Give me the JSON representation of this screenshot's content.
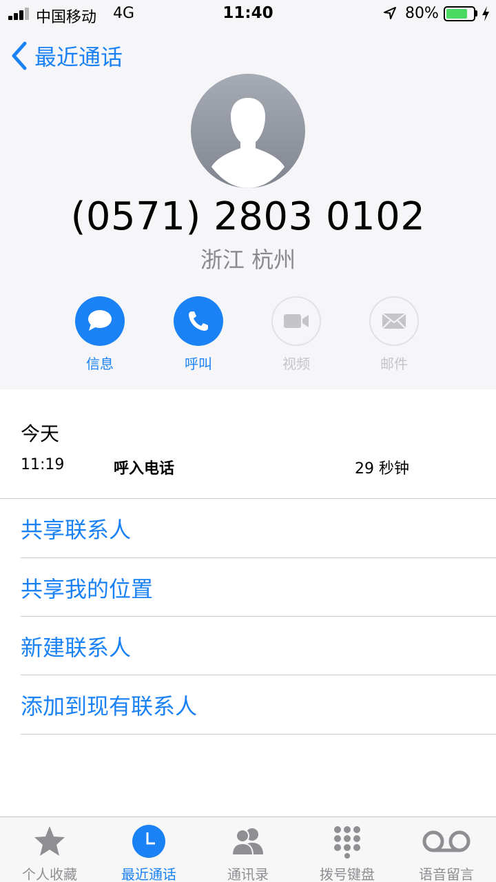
{
  "status_bar": {
    "carrier": "中国移动",
    "network": "4G",
    "time": "11:40",
    "battery_percent": "80%",
    "battery_level": 0.8
  },
  "nav": {
    "back_label": "最近通话"
  },
  "contact": {
    "phone_number": "(0571) 2803 0102",
    "location": "浙江 杭州"
  },
  "actions": [
    {
      "label": "信息",
      "icon": "message-icon",
      "enabled": true
    },
    {
      "label": "呼叫",
      "icon": "phone-icon",
      "enabled": true
    },
    {
      "label": "视频",
      "icon": "video-icon",
      "enabled": false
    },
    {
      "label": "邮件",
      "icon": "mail-icon",
      "enabled": false
    }
  ],
  "call_history": {
    "day": "今天",
    "entries": [
      {
        "time": "11:19",
        "type": "呼入电话",
        "duration": "29 秒钟"
      }
    ]
  },
  "options": [
    "共享联系人",
    "共享我的位置",
    "新建联系人",
    "添加到现有联系人"
  ],
  "tabs": [
    {
      "label": "个人收藏",
      "icon": "star-icon",
      "active": false
    },
    {
      "label": "最近通话",
      "icon": "clock-icon",
      "active": true
    },
    {
      "label": "通讯录",
      "icon": "contacts-icon",
      "active": false
    },
    {
      "label": "拨号键盘",
      "icon": "keypad-icon",
      "active": false
    },
    {
      "label": "语音留言",
      "icon": "voicemail-icon",
      "active": false
    }
  ],
  "colors": {
    "accent": "#1a82f5",
    "disabled": "#c4c4c9",
    "battery": "#4cd964",
    "header_bg": "#f6f6f9"
  }
}
